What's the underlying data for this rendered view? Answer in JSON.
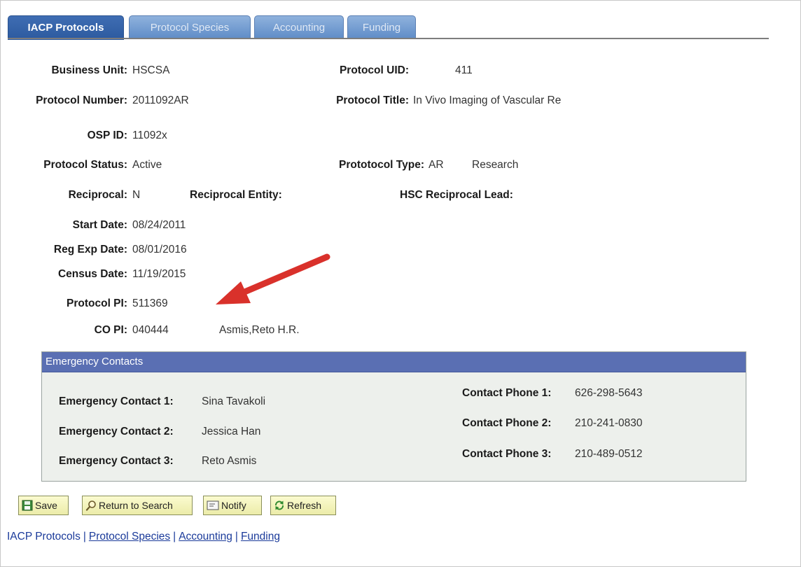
{
  "tabs": [
    {
      "label": "IACP Protocols",
      "active": true
    },
    {
      "label": "Protocol Species",
      "active": false
    },
    {
      "label": "Accounting",
      "active": false
    },
    {
      "label": "Funding",
      "active": false
    }
  ],
  "fields": {
    "business_unit": {
      "label": "Business Unit:",
      "value": "HSCSA"
    },
    "protocol_uid": {
      "label": "Protocol UID:",
      "value": "411"
    },
    "protocol_number": {
      "label": "Protocol Number:",
      "value": "2011092AR"
    },
    "protocol_title": {
      "label": "Protocol Title:",
      "value": "In Vivo Imaging of Vascular Re"
    },
    "osp_id": {
      "label": "OSP ID:",
      "value": "11092x"
    },
    "protocol_status": {
      "label": "Protocol Status:",
      "value": "Active"
    },
    "protocol_type": {
      "label": "Prototocol Type:",
      "value": "AR",
      "description": "Research"
    },
    "reciprocal": {
      "label": "Reciprocal:",
      "value": "N"
    },
    "reciprocal_entity": {
      "label": "Reciprocal Entity:",
      "value": ""
    },
    "hsc_reciprocal_lead": {
      "label": "HSC Reciprocal Lead:",
      "value": ""
    },
    "start_date": {
      "label": "Start Date:",
      "value": "08/24/2011"
    },
    "reg_exp_date": {
      "label": "Reg Exp Date:",
      "value": "08/01/2016"
    },
    "census_date": {
      "label": "Census Date:",
      "value": "11/19/2015"
    },
    "protocol_pi": {
      "label": "Protocol PI:",
      "value": "511369"
    },
    "co_pi": {
      "label": "CO PI:",
      "value": "040444",
      "name": "Asmis,Reto H.R."
    }
  },
  "emergency": {
    "title": "Emergency Contacts",
    "contacts": [
      {
        "label": "Emergency Contact 1:",
        "value": "Sina Tavakoli",
        "phone_label": "Contact Phone 1:",
        "phone": "626-298-5643"
      },
      {
        "label": "Emergency Contact 2:",
        "value": "Jessica Han",
        "phone_label": "Contact Phone 2:",
        "phone": "210-241-0830"
      },
      {
        "label": "Emergency Contact 3:",
        "value": "Reto Asmis",
        "phone_label": "Contact Phone 3:",
        "phone": "210-489-0512"
      }
    ]
  },
  "toolbar": {
    "save": "Save",
    "return_to_search": "Return to Search",
    "notify": "Notify",
    "refresh": "Refresh"
  },
  "footer": {
    "links": [
      "IACP Protocols",
      "Protocol Species",
      "Accounting",
      "Funding"
    ],
    "separator": "|"
  },
  "colors": {
    "tab_active": "#2c5a9f",
    "tab_inactive": "#6f98cf",
    "section_header": "#5a6fb3",
    "section_bg": "#edf0ec",
    "button_bg": "#f3f3bd",
    "arrow": "#d9312b",
    "link": "#1a3a9a"
  }
}
